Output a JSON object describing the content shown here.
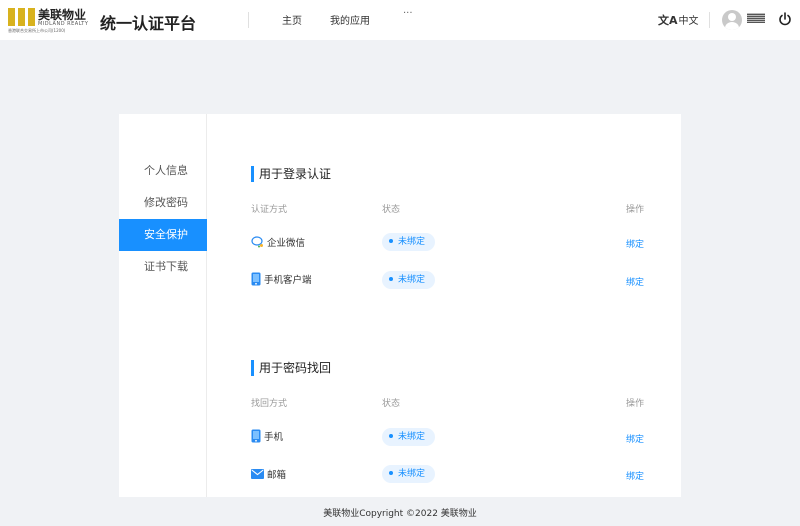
{
  "header": {
    "logo_cn": "美联物业",
    "logo_en": "MIDLAND REALTY",
    "logo_sub": "香港联合交易所上市公司(1200)",
    "app_title": "统一认证平台",
    "nav": [
      {
        "label": "主页"
      },
      {
        "label": "我的应用"
      }
    ],
    "more": "···",
    "lang_icon": "文A",
    "lang": "中文"
  },
  "sidebar": {
    "items": [
      {
        "label": "个人信息"
      },
      {
        "label": "修改密码"
      },
      {
        "label": "安全保护",
        "active": true
      },
      {
        "label": "证书下载"
      }
    ]
  },
  "login_section": {
    "title": "用于登录认证",
    "col_method": "认证方式",
    "col_status": "状态",
    "col_action": "操作",
    "rows": [
      {
        "icon": "wecom-icon",
        "label": "企业微信",
        "status": "未绑定",
        "action": "绑定"
      },
      {
        "icon": "mobile-icon",
        "label": "手机客户端",
        "status": "未绑定",
        "action": "绑定"
      }
    ]
  },
  "recovery_section": {
    "title": "用于密码找回",
    "col_method": "找回方式",
    "col_status": "状态",
    "col_action": "操作",
    "rows": [
      {
        "icon": "phone-icon",
        "label": "手机",
        "status": "未绑定",
        "action": "绑定"
      },
      {
        "icon": "mail-icon",
        "label": "邮箱",
        "status": "未绑定",
        "action": "绑定"
      }
    ]
  },
  "footer": "美联物业Copyright ©2022 美联物业",
  "colors": {
    "accent": "#1890ff",
    "status_bg": "#e8f3ff",
    "logo_gold": "#d8b21e",
    "page_bg": "#f0f2f5"
  }
}
